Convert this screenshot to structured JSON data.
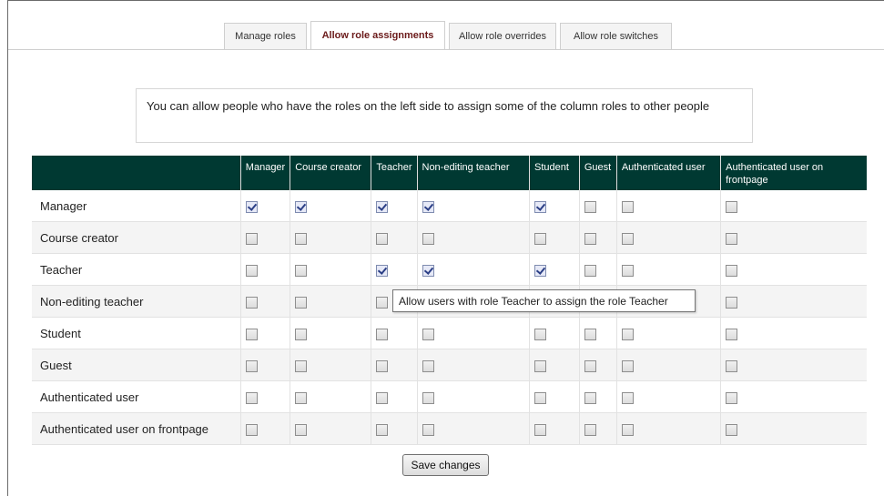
{
  "tabs": [
    {
      "label": "Manage roles",
      "active": false
    },
    {
      "label": "Allow role assignments",
      "active": true
    },
    {
      "label": "Allow role overrides",
      "active": false
    },
    {
      "label": "Allow role switches",
      "active": false
    }
  ],
  "notice": {
    "text": "You can allow people who have the roles on the left side to assign some of the column roles to other people"
  },
  "table": {
    "columns": [
      "Manager",
      "Course creator",
      "Teacher",
      "Non-editing teacher",
      "Student",
      "Guest",
      "Authenticated user",
      "Authenticated user on frontpage"
    ],
    "rows": [
      {
        "label": "Manager",
        "checked": [
          true,
          true,
          true,
          true,
          true,
          false,
          false,
          false
        ]
      },
      {
        "label": "Course creator",
        "checked": [
          false,
          false,
          false,
          false,
          false,
          false,
          false,
          false
        ]
      },
      {
        "label": "Teacher",
        "checked": [
          false,
          false,
          true,
          true,
          true,
          false,
          false,
          false
        ]
      },
      {
        "label": "Non-editing teacher",
        "checked": [
          false,
          false,
          false,
          false,
          false,
          false,
          false,
          false
        ]
      },
      {
        "label": "Student",
        "checked": [
          false,
          false,
          false,
          false,
          false,
          false,
          false,
          false
        ]
      },
      {
        "label": "Guest",
        "checked": [
          false,
          false,
          false,
          false,
          false,
          false,
          false,
          false
        ]
      },
      {
        "label": "Authenticated user",
        "checked": [
          false,
          false,
          false,
          false,
          false,
          false,
          false,
          false
        ]
      },
      {
        "label": "Authenticated user on frontpage",
        "checked": [
          false,
          false,
          false,
          false,
          false,
          false,
          false,
          false
        ]
      }
    ]
  },
  "tooltip": {
    "text": "Allow users with role Teacher to assign the role Teacher"
  },
  "actions": {
    "save_label": "Save changes"
  },
  "colors": {
    "header_bg": "#003932",
    "active_tab_text": "#6b1a1a"
  }
}
